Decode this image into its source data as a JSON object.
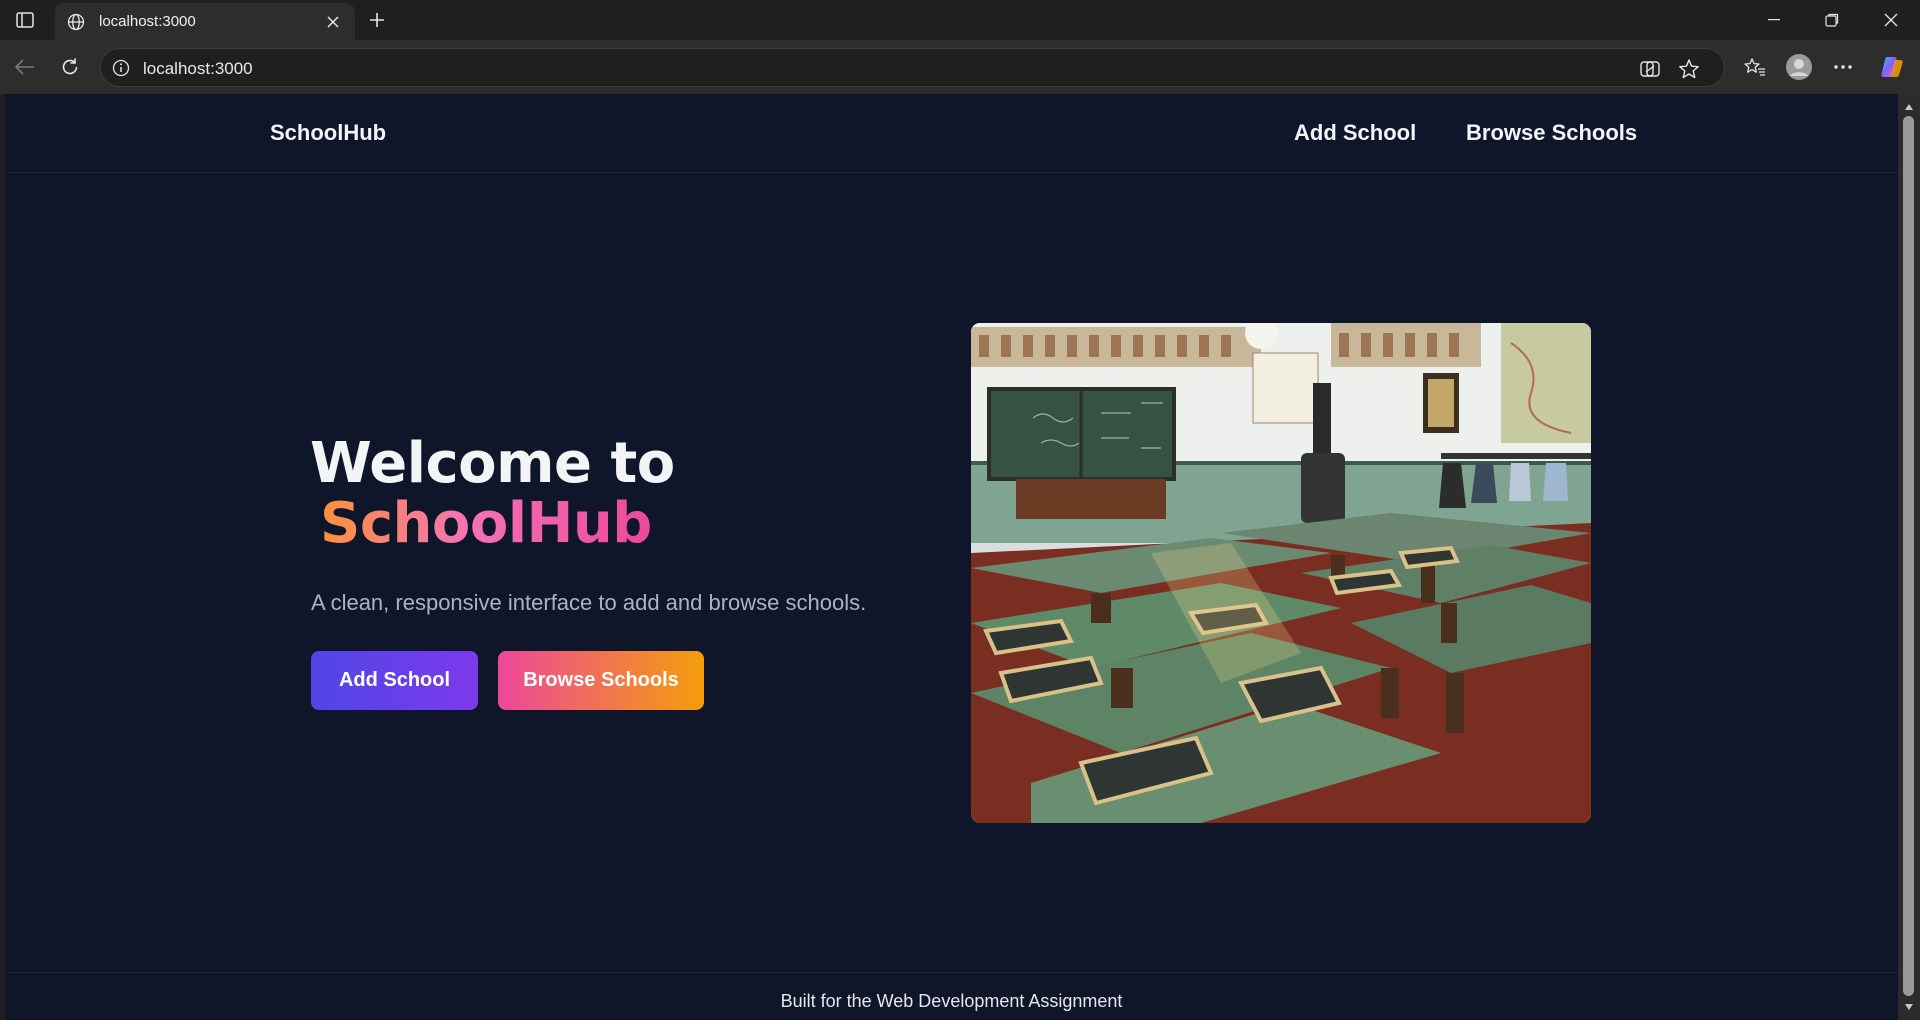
{
  "browser": {
    "tab_title": "localhost:3000",
    "url": "localhost:3000"
  },
  "site": {
    "brand": "SchoolHub",
    "nav": [
      {
        "label": "Add School"
      },
      {
        "label": "Browse Schools"
      }
    ]
  },
  "hero": {
    "title_line1": "Welcome to",
    "title_highlight": "SchoolHub",
    "subtitle": "A clean, responsive interface to add and browse schools.",
    "buttons": [
      {
        "label": "Add School"
      },
      {
        "label": "Browse Schools"
      }
    ],
    "image_alt": "classroom-photo"
  },
  "footer": {
    "text": "Built for the Web Development Assignment"
  },
  "colors": {
    "page_bg": "#0f1629",
    "add_btn_gradient": [
      "#4f46e5",
      "#7c3aed"
    ],
    "browse_btn_gradient": [
      "#ec4899",
      "#f59e0b"
    ],
    "title_gradient": [
      "#fb923c",
      "#ec4899"
    ]
  }
}
